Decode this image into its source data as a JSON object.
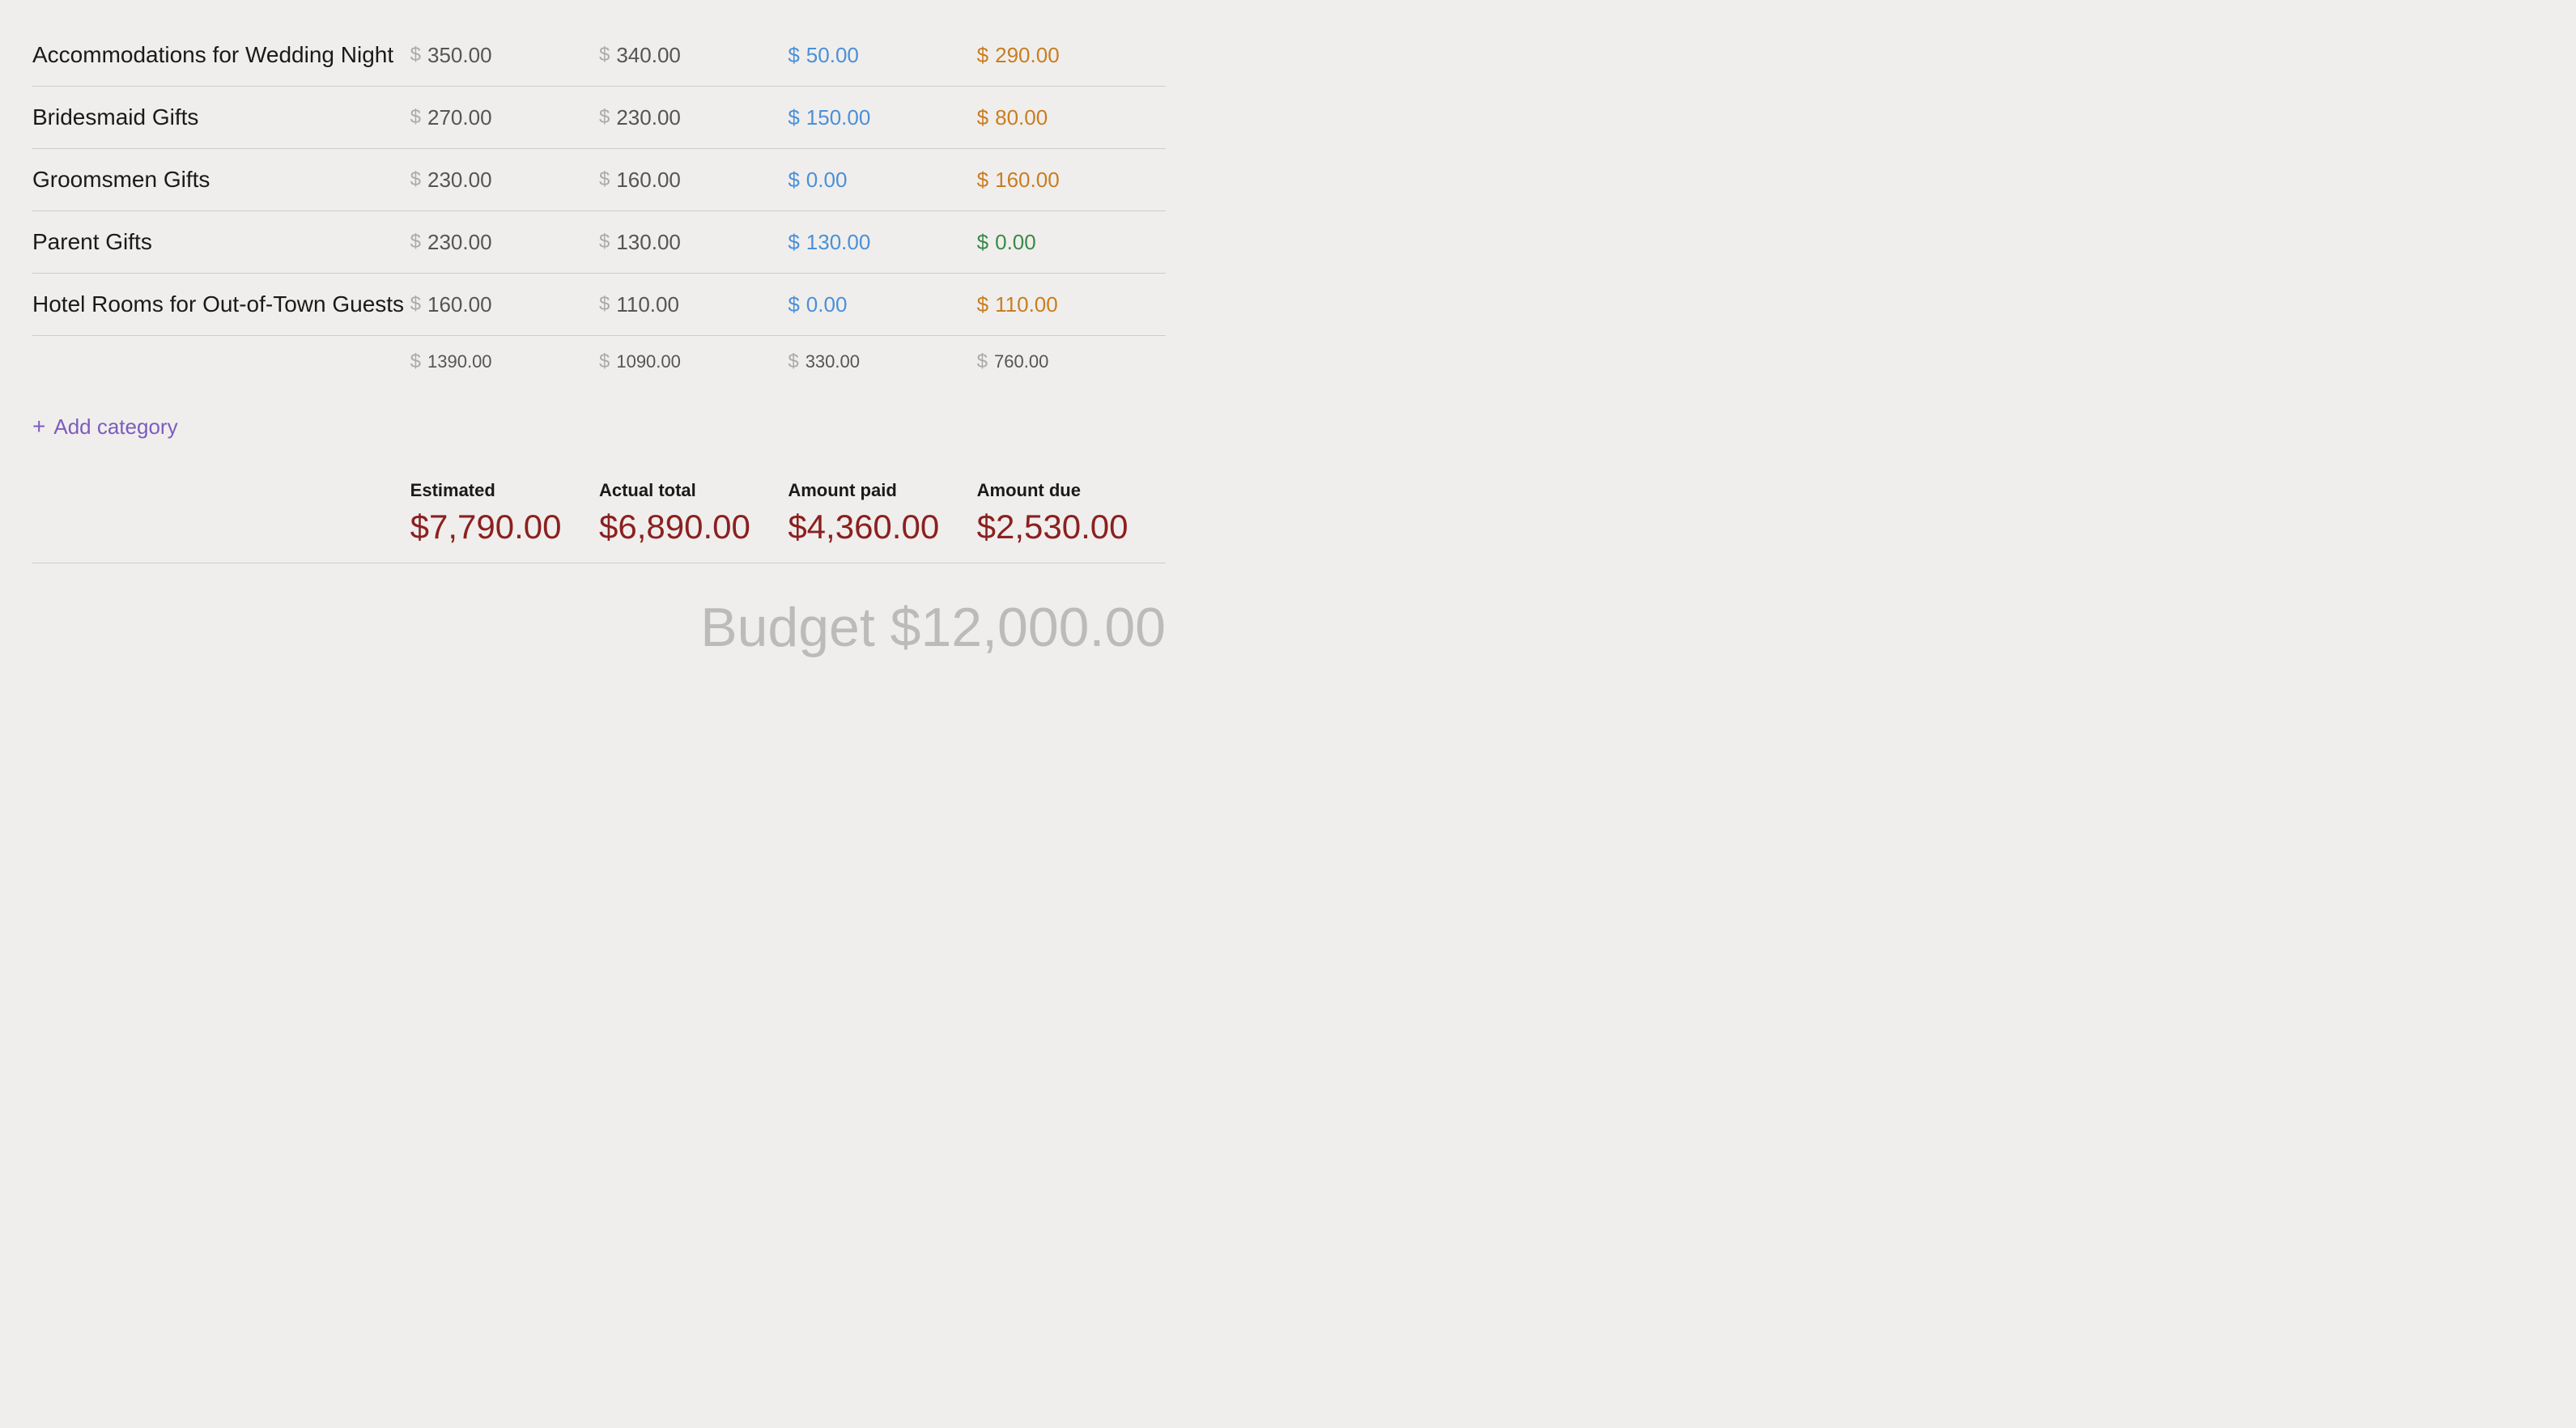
{
  "rows": [
    {
      "name": "Accommodations for Wedding Night",
      "estimated": "350.00",
      "actual": "340.00",
      "paid": "50.00",
      "paid_color": "blue",
      "due": "290.00",
      "due_color": "orange"
    },
    {
      "name": "Bridesmaid Gifts",
      "estimated": "270.00",
      "actual": "230.00",
      "paid": "150.00",
      "paid_color": "blue",
      "due": "80.00",
      "due_color": "orange"
    },
    {
      "name": "Groomsmen Gifts",
      "estimated": "230.00",
      "actual": "160.00",
      "paid": "0.00",
      "paid_color": "blue",
      "due": "160.00",
      "due_color": "orange"
    },
    {
      "name": "Parent Gifts",
      "estimated": "230.00",
      "actual": "130.00",
      "paid": "130.00",
      "paid_color": "blue",
      "due": "0.00",
      "due_color": "green"
    },
    {
      "name": "Hotel Rooms for Out-of-Town Guests",
      "estimated": "160.00",
      "actual": "110.00",
      "paid": "0.00",
      "paid_color": "blue",
      "due": "110.00",
      "due_color": "orange"
    }
  ],
  "totals": {
    "estimated": "1390.00",
    "actual": "1090.00",
    "paid": "330.00",
    "due": "760.00"
  },
  "add_category_label": "Add category",
  "summary": {
    "estimated_label": "Estimated",
    "estimated_value": "$7,790.00",
    "actual_label": "Actual total",
    "actual_value": "$6,890.00",
    "paid_label": "Amount paid",
    "paid_value": "$4,360.00",
    "due_label": "Amount due",
    "due_value": "$2,530.00"
  },
  "budget_label": "Budget $12,000.00"
}
